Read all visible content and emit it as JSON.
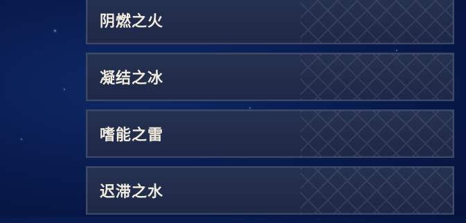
{
  "dialogue_options": [
    {
      "label": "阴燃之火"
    },
    {
      "label": "凝结之冰"
    },
    {
      "label": "嗜能之雷"
    },
    {
      "label": "迟滞之水"
    }
  ],
  "colors": {
    "background": "#0a1f55",
    "option_fill": "#1f2b4b",
    "option_border": "#3b4a6a",
    "option_text": "#f1ecdf"
  }
}
